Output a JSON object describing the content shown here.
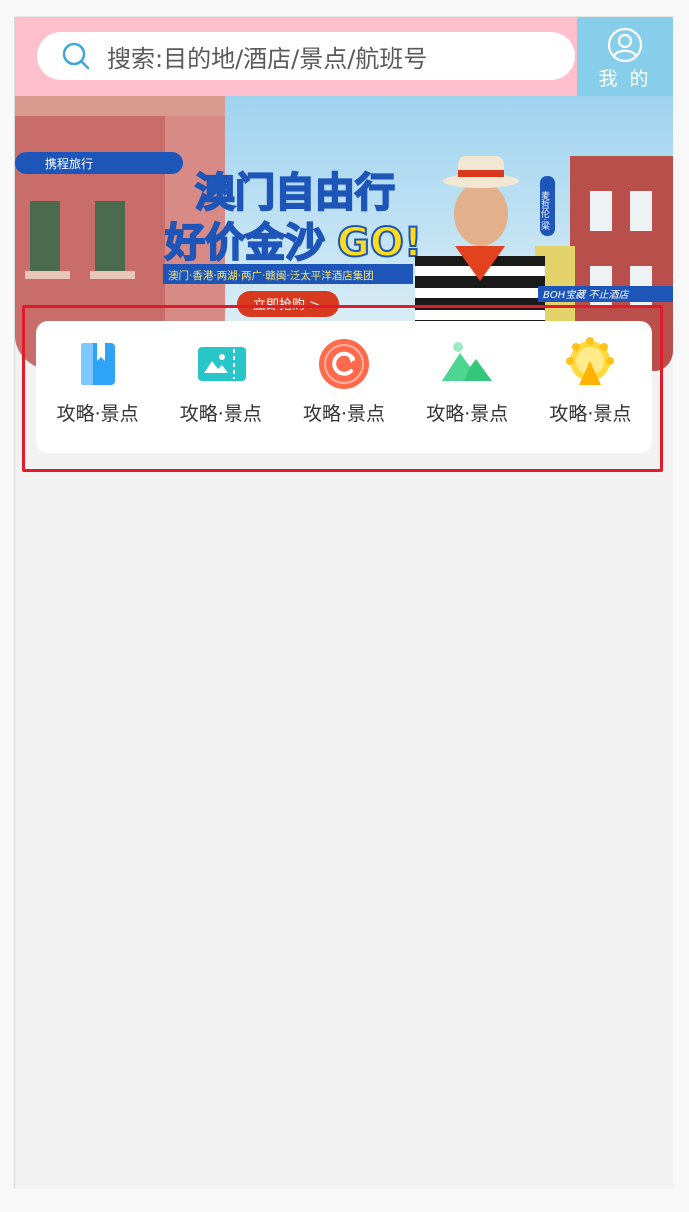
{
  "search": {
    "placeholder": "搜索:目的地/酒店/景点/航班号"
  },
  "profile": {
    "label": "我 的"
  },
  "banner": {
    "brand": "携程旅行",
    "title_line1": "澳门自由行",
    "title_line2": "好价金沙",
    "title_go": "GO!",
    "subtitle": "澳门·香港·两湖·两广·赣闽·泛太平洋酒店集团",
    "cta": "立即抢购 >",
    "person_name": "麦哲伦·梁",
    "slogan": "BOH宝藏 不止酒店"
  },
  "categories": [
    {
      "label": "攻略·景点",
      "icon": "book-icon"
    },
    {
      "label": "攻略·景点",
      "icon": "ticket-icon"
    },
    {
      "label": "攻略·景点",
      "icon": "badge-icon"
    },
    {
      "label": "攻略·景点",
      "icon": "mountain-icon"
    },
    {
      "label": "攻略·景点",
      "icon": "ferris-wheel-icon"
    }
  ],
  "colors": {
    "header_bg": "#ffbfcc",
    "profile_bg": "#87ceeb",
    "highlight": "#e01b2a"
  }
}
